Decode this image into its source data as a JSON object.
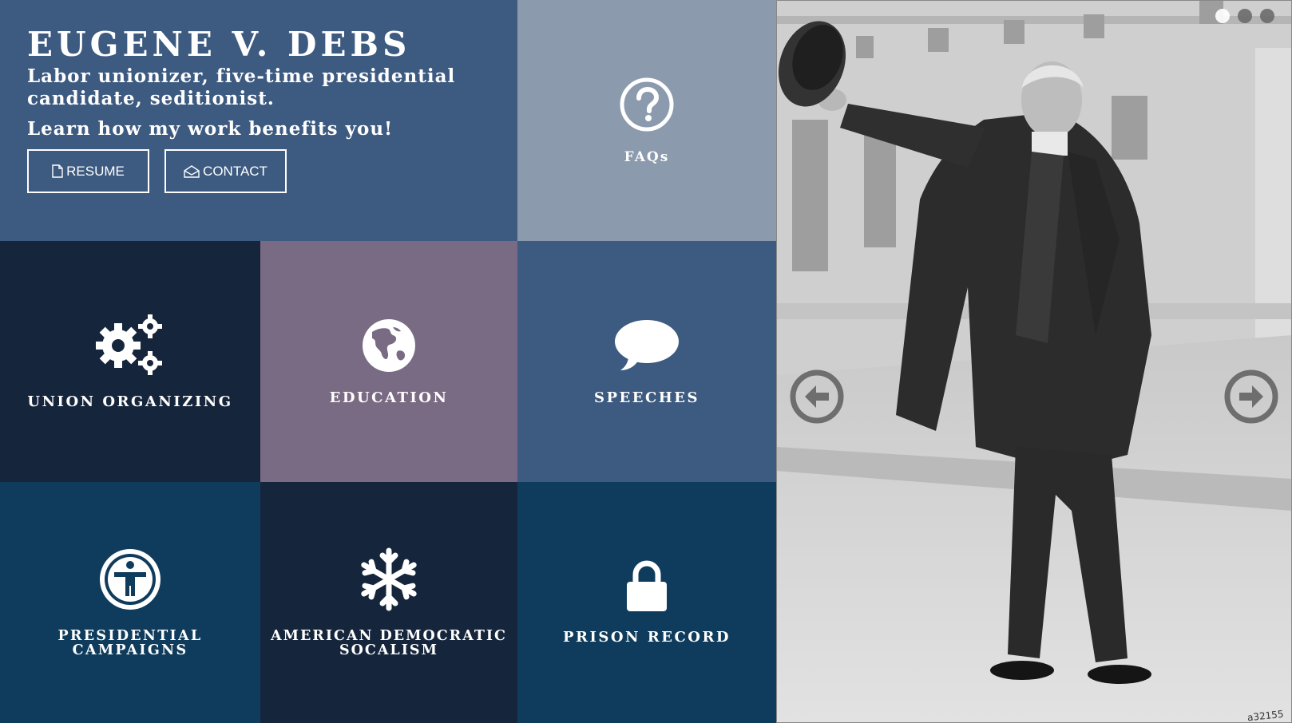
{
  "hero": {
    "title": "EUGENE V. DEBS",
    "tagline": "Labor unionizer, five-time presidential candidate, seditionist.",
    "cta": "Learn how my work benefits you!",
    "resume_label": "RESUME",
    "contact_label": "CONTACT"
  },
  "tiles": {
    "faq": {
      "label": "FAQs",
      "icon": "question-circle-icon"
    },
    "union": {
      "label": "UNION ORGANIZING",
      "icon": "gears-icon"
    },
    "education": {
      "label": "EDUCATION",
      "icon": "globe-icon"
    },
    "speeches": {
      "label": "SPEECHES",
      "icon": "speech-bubble-icon"
    },
    "presidential": {
      "label": "PRESIDENTIAL CAMPAIGNS",
      "icon": "person-circle-icon"
    },
    "socialism": {
      "label": "AMERICAN DEMOCRATIC SOCALISM",
      "icon": "snowflake-icon"
    },
    "prison": {
      "label": "PRISON RECORD",
      "icon": "lock-icon"
    }
  },
  "carousel": {
    "slide_count": 3,
    "active_slide": 1,
    "watermark": "a32155"
  },
  "colors": {
    "slate_blue": "#3d5a80",
    "gray_blue": "#8c9aad",
    "navy": "#15253b",
    "mauve": "#7a6b84",
    "teal_navy": "#0f3c5c"
  }
}
